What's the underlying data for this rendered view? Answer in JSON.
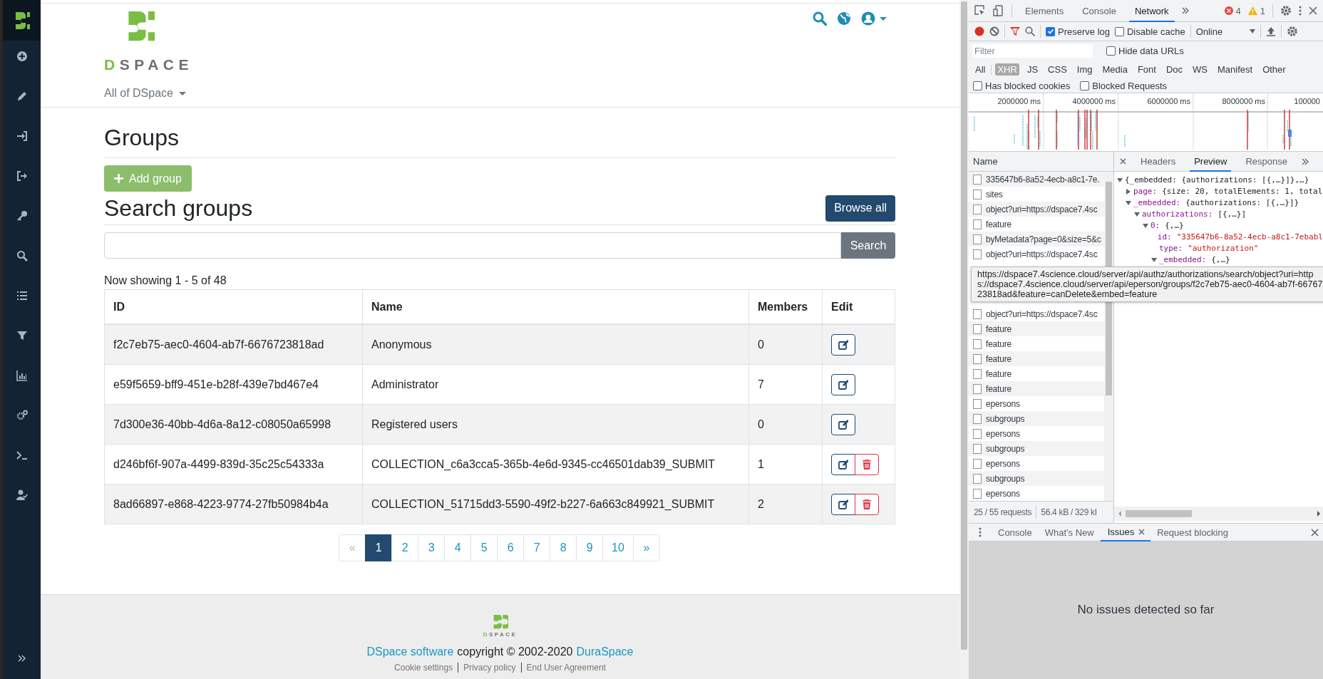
{
  "header": {
    "logo_text": "DSPACE",
    "scope": "All of DSpace"
  },
  "page": {
    "title": "Groups",
    "add_button": "Add group",
    "search_title": "Search groups",
    "browse_button": "Browse all",
    "search_button": "Search",
    "showing": "Now showing 1 - 5 of 48"
  },
  "table": {
    "columns": [
      "ID",
      "Name",
      "Members",
      "Edit"
    ],
    "rows": [
      {
        "id": "f2c7eb75-aec0-4604-ab7f-6676723818ad",
        "name": "Anonymous",
        "members": "0",
        "deletable": false
      },
      {
        "id": "e59f5659-bff9-451e-b28f-439e7bd467e4",
        "name": "Administrator",
        "members": "7",
        "deletable": false
      },
      {
        "id": "7d300e36-40bb-4d6a-8a12-c08050a65998",
        "name": "Registered users",
        "members": "0",
        "deletable": false
      },
      {
        "id": "d246bf6f-907a-4499-839d-35c25c54333a",
        "name": "COLLECTION_c6a3cca5-365b-4e6d-9345-cc46501dab39_SUBMIT",
        "members": "1",
        "deletable": true
      },
      {
        "id": "8ad66897-e868-4223-9774-27fb50984b4a",
        "name": "COLLECTION_51715dd3-5590-49f2-b227-6a663c849921_SUBMIT",
        "members": "2",
        "deletable": true
      }
    ]
  },
  "pagination": [
    {
      "label": "«",
      "selected": false,
      "disabled": true
    },
    {
      "label": "1",
      "selected": true,
      "disabled": false
    },
    {
      "label": "2",
      "selected": false,
      "disabled": false
    },
    {
      "label": "3",
      "selected": false,
      "disabled": false
    },
    {
      "label": "4",
      "selected": false,
      "disabled": false
    },
    {
      "label": "5",
      "selected": false,
      "disabled": false
    },
    {
      "label": "6",
      "selected": false,
      "disabled": false
    },
    {
      "label": "7",
      "selected": false,
      "disabled": false
    },
    {
      "label": "8",
      "selected": false,
      "disabled": false
    },
    {
      "label": "9",
      "selected": false,
      "disabled": false
    },
    {
      "label": "10",
      "selected": false,
      "disabled": false
    },
    {
      "label": "»",
      "selected": false,
      "disabled": false
    }
  ],
  "footer": {
    "logo_text": "DSPACE",
    "software_link": "DSpace software",
    "copyright": "copyright © 2002-2020",
    "company_link": "DuraSpace",
    "links": [
      "Cookie settings",
      "Privacy policy",
      "End User Agreement"
    ]
  },
  "devtools": {
    "tabs": [
      {
        "label": "Elements",
        "selected": false
      },
      {
        "label": "Console",
        "selected": false
      },
      {
        "label": "Network",
        "selected": true
      }
    ],
    "errors": "4",
    "warnings": "1",
    "preserve_log": {
      "label": "Preserve log",
      "checked": true
    },
    "disable_cache": {
      "label": "Disable cache",
      "checked": false
    },
    "throttling": "Online",
    "filter": {
      "placeholder": "Filter"
    },
    "hide_data_urls": {
      "label": "Hide data URLs",
      "checked": false
    },
    "type_filters": [
      {
        "label": "All",
        "selected": false
      },
      {
        "label": "XHR",
        "selected": true
      },
      {
        "label": "JS",
        "selected": false
      },
      {
        "label": "CSS",
        "selected": false
      },
      {
        "label": "Img",
        "selected": false
      },
      {
        "label": "Media",
        "selected": false
      },
      {
        "label": "Font",
        "selected": false
      },
      {
        "label": "Doc",
        "selected": false
      },
      {
        "label": "WS",
        "selected": false
      },
      {
        "label": "Manifest",
        "selected": false
      },
      {
        "label": "Other",
        "selected": false
      }
    ],
    "blocked_filters": [
      {
        "label": "Has blocked cookies",
        "checked": false
      },
      {
        "label": "Blocked Requests",
        "checked": false
      }
    ],
    "overview_ticks": [
      "2000000 ms",
      "4000000 ms",
      "6000000 ms",
      "8000000 ms",
      "100000"
    ],
    "name_column": "Name",
    "requests_top": [
      "335647b6-8a52-4ecb-a8c1-7e.",
      "sites",
      "object?uri=https://dspace7.4sc",
      "feature",
      "byMetadata?page=0&size=5&c",
      "object?uri=https://dspace7.4sc"
    ],
    "requests_bottom": [
      "object?uri=https://dspace7.4sc",
      "feature",
      "feature",
      "feature",
      "feature",
      "feature",
      "epersons",
      "subgroups",
      "epersons",
      "subgroups",
      "epersons",
      "subgroups",
      "epersons"
    ],
    "tooltip": "https://dspace7.4science.cloud/server/api/authz/authorizations/search/object?uri=https://dspace7.4science.cloud/server/api/eperson/groups/f2c7eb75-aec0-4604-ab7f-6676723818ad&feature=canDelete&embed=feature",
    "detail_tabs": [
      {
        "label": "Headers",
        "selected": false
      },
      {
        "label": "Preview",
        "selected": true
      },
      {
        "label": "Response",
        "selected": false
      }
    ],
    "tree": [
      {
        "summary": "{_embedded: {authorizations: [{,…}]},…}",
        "expanded": true,
        "children": [
          {
            "key": "page:",
            "summary": "{size: 20, totalElements: 1, total",
            "expanded": false
          },
          {
            "key": "_embedded:",
            "summary": "{authorizations: [{,…}]}",
            "expanded": true,
            "children": [
              {
                "key": "authorizations:",
                "summary": "[{,…}]",
                "expanded": true,
                "children": [
                  {
                    "key": "0:",
                    "summary": "{,…}",
                    "expanded": true,
                    "children": [
                      {
                        "key": "id:",
                        "value": "\"335647b6-8a52-4ecb-a8c1-7ebabl"
                      },
                      {
                        "key": "type:",
                        "value": "\"authorization\""
                      },
                      {
                        "key": "_embedded:",
                        "summary": "{,…}",
                        "expanded": true
                      }
                    ]
                  }
                ]
              }
            ]
          }
        ]
      }
    ],
    "status": {
      "requests": "25 / 55 requests",
      "transferred": "56.4 kB / 329 kI"
    },
    "drawer_tabs": [
      {
        "label": "Console",
        "selected": false,
        "closable": false
      },
      {
        "label": "What's New",
        "selected": false,
        "closable": false
      },
      {
        "label": "Issues",
        "selected": true,
        "closable": true
      },
      {
        "label": "Request blocking",
        "selected": false,
        "closable": false
      }
    ],
    "drawer_message": "No issues detected so far"
  }
}
